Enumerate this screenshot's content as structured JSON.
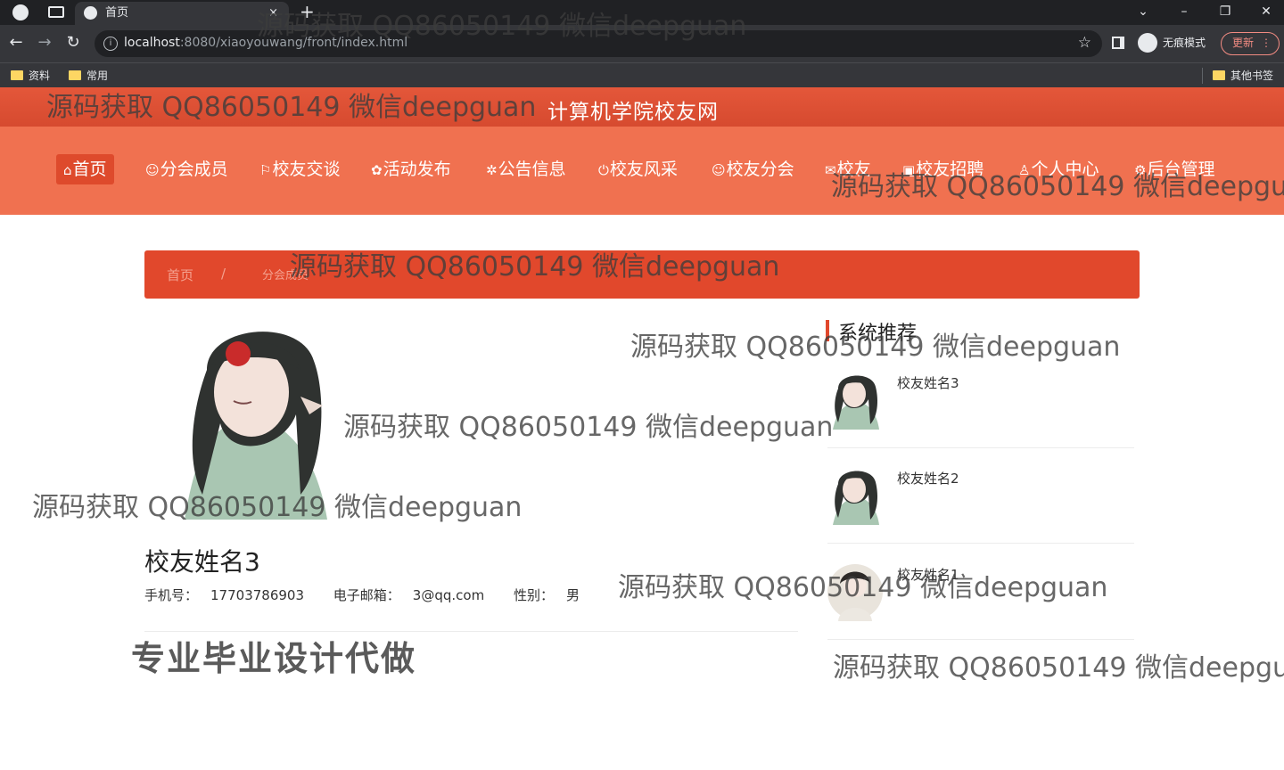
{
  "browser": {
    "tab_title": "首页",
    "tab_close": "×",
    "new_tab": "+",
    "url_host": "localhost",
    "url_path": ":8080/xiaoyouwang/front/index.html",
    "incognito_label": "无痕模式",
    "update_label": "更新",
    "bookmarks": [
      "资料",
      "常用"
    ],
    "other_bookmarks": "其他书签"
  },
  "site": {
    "title": "计算机学院校友网",
    "menu": [
      {
        "glyph": "⌂",
        "label": "首页"
      },
      {
        "glyph": "☺",
        "label": "分会成员"
      },
      {
        "glyph": "⚐",
        "label": "校友交谈"
      },
      {
        "glyph": "✿",
        "label": "活动发布"
      },
      {
        "glyph": "✲",
        "label": "公告信息"
      },
      {
        "glyph": "⏻",
        "label": "校友风采"
      },
      {
        "glyph": "☺",
        "label": "校友分会"
      },
      {
        "glyph": "✉",
        "label": "校友"
      },
      {
        "glyph": "▣",
        "label": "校友招聘"
      },
      {
        "glyph": "♙",
        "label": "个人中心"
      },
      {
        "glyph": "⚙",
        "label": "后台管理"
      }
    ]
  },
  "breadcrumb": {
    "home": "首页",
    "sep": "/",
    "current": "分会成员"
  },
  "detail": {
    "name": "校友姓名3",
    "phone_label": "手机号：",
    "phone": "17703786903",
    "email_label": "电子邮箱：",
    "email": "3@qq.com",
    "gender_label": "性别：",
    "gender": "男"
  },
  "sidebar": {
    "title": "系统推荐",
    "items": [
      {
        "name": "校友姓名3"
      },
      {
        "name": "校友姓名2"
      },
      {
        "name": "校友姓名1"
      }
    ]
  },
  "promo": "专业毕业设计代做",
  "watermark": "源码获取 QQ86050149 微信deepguan",
  "colors": {
    "header": "#e1482c",
    "menu": "#f07150",
    "menu_active": "#de4a2c"
  }
}
